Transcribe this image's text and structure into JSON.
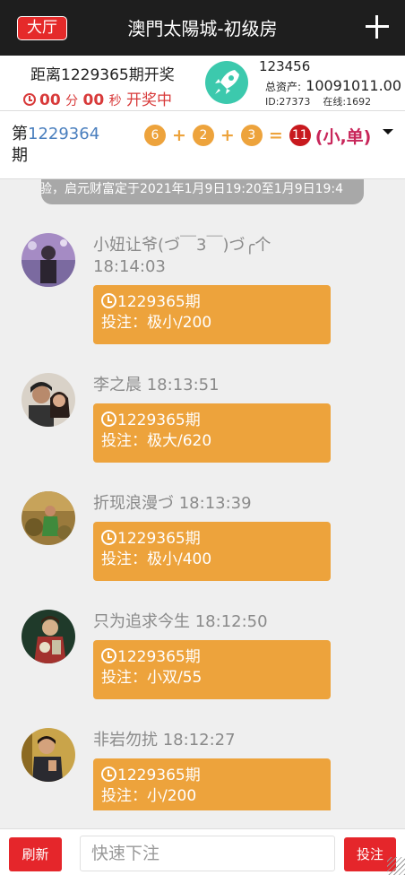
{
  "header": {
    "hall_label": "大厅",
    "title": "澳門太陽城-初级房"
  },
  "info": {
    "next_draw": "距离1229365期开奖",
    "countdown": {
      "minutes": "00",
      "minutes_unit": "分",
      "seconds": "00",
      "seconds_unit": "秒",
      "status": "开奖中"
    },
    "username": "123456",
    "assets_label": "总资产:",
    "assets_value": "10091011.00",
    "id_text": "ID:27373",
    "online_text": "在线:1692"
  },
  "result": {
    "prefix": "第",
    "period": "1229364",
    "suffix": "期",
    "balls": [
      "6",
      "2",
      "3"
    ],
    "plus": "+",
    "equals": "=",
    "sum": "11",
    "tag": "(小,单)"
  },
  "marquee": "验，启元财富定于2021年1月9日19:20至1月9日19:4",
  "messages": [
    {
      "name": "小妞让爷(づ￣3￣)づ╭个",
      "time": "18:14:03",
      "period": "1229365期",
      "bet": "投注：极小/200"
    },
    {
      "name": "李之晨",
      "time": "18:13:51",
      "period": "1229365期",
      "bet": "投注：极大/620"
    },
    {
      "name": "折现浪漫づ",
      "time": "18:13:39",
      "period": "1229365期",
      "bet": "投注：极小/400"
    },
    {
      "name": "只为追求今生",
      "time": "18:12:50",
      "period": "1229365期",
      "bet": "投注：小双/55"
    },
    {
      "name": "非岩勿扰",
      "time": "18:12:27",
      "period": "1229365期",
      "bet": "投注：小/200"
    }
  ],
  "bottom": {
    "refresh_label": "刷新",
    "input_placeholder": "快速下注",
    "bet_label": "投注"
  },
  "colors": {
    "header_bg": "#1e1e1e",
    "accent_red": "#e5262b",
    "bubble_orange": "#eda33c",
    "period_blue": "#4a7fbe",
    "result_tag": "#c8265a",
    "rocket_green": "#3cc9ad"
  }
}
